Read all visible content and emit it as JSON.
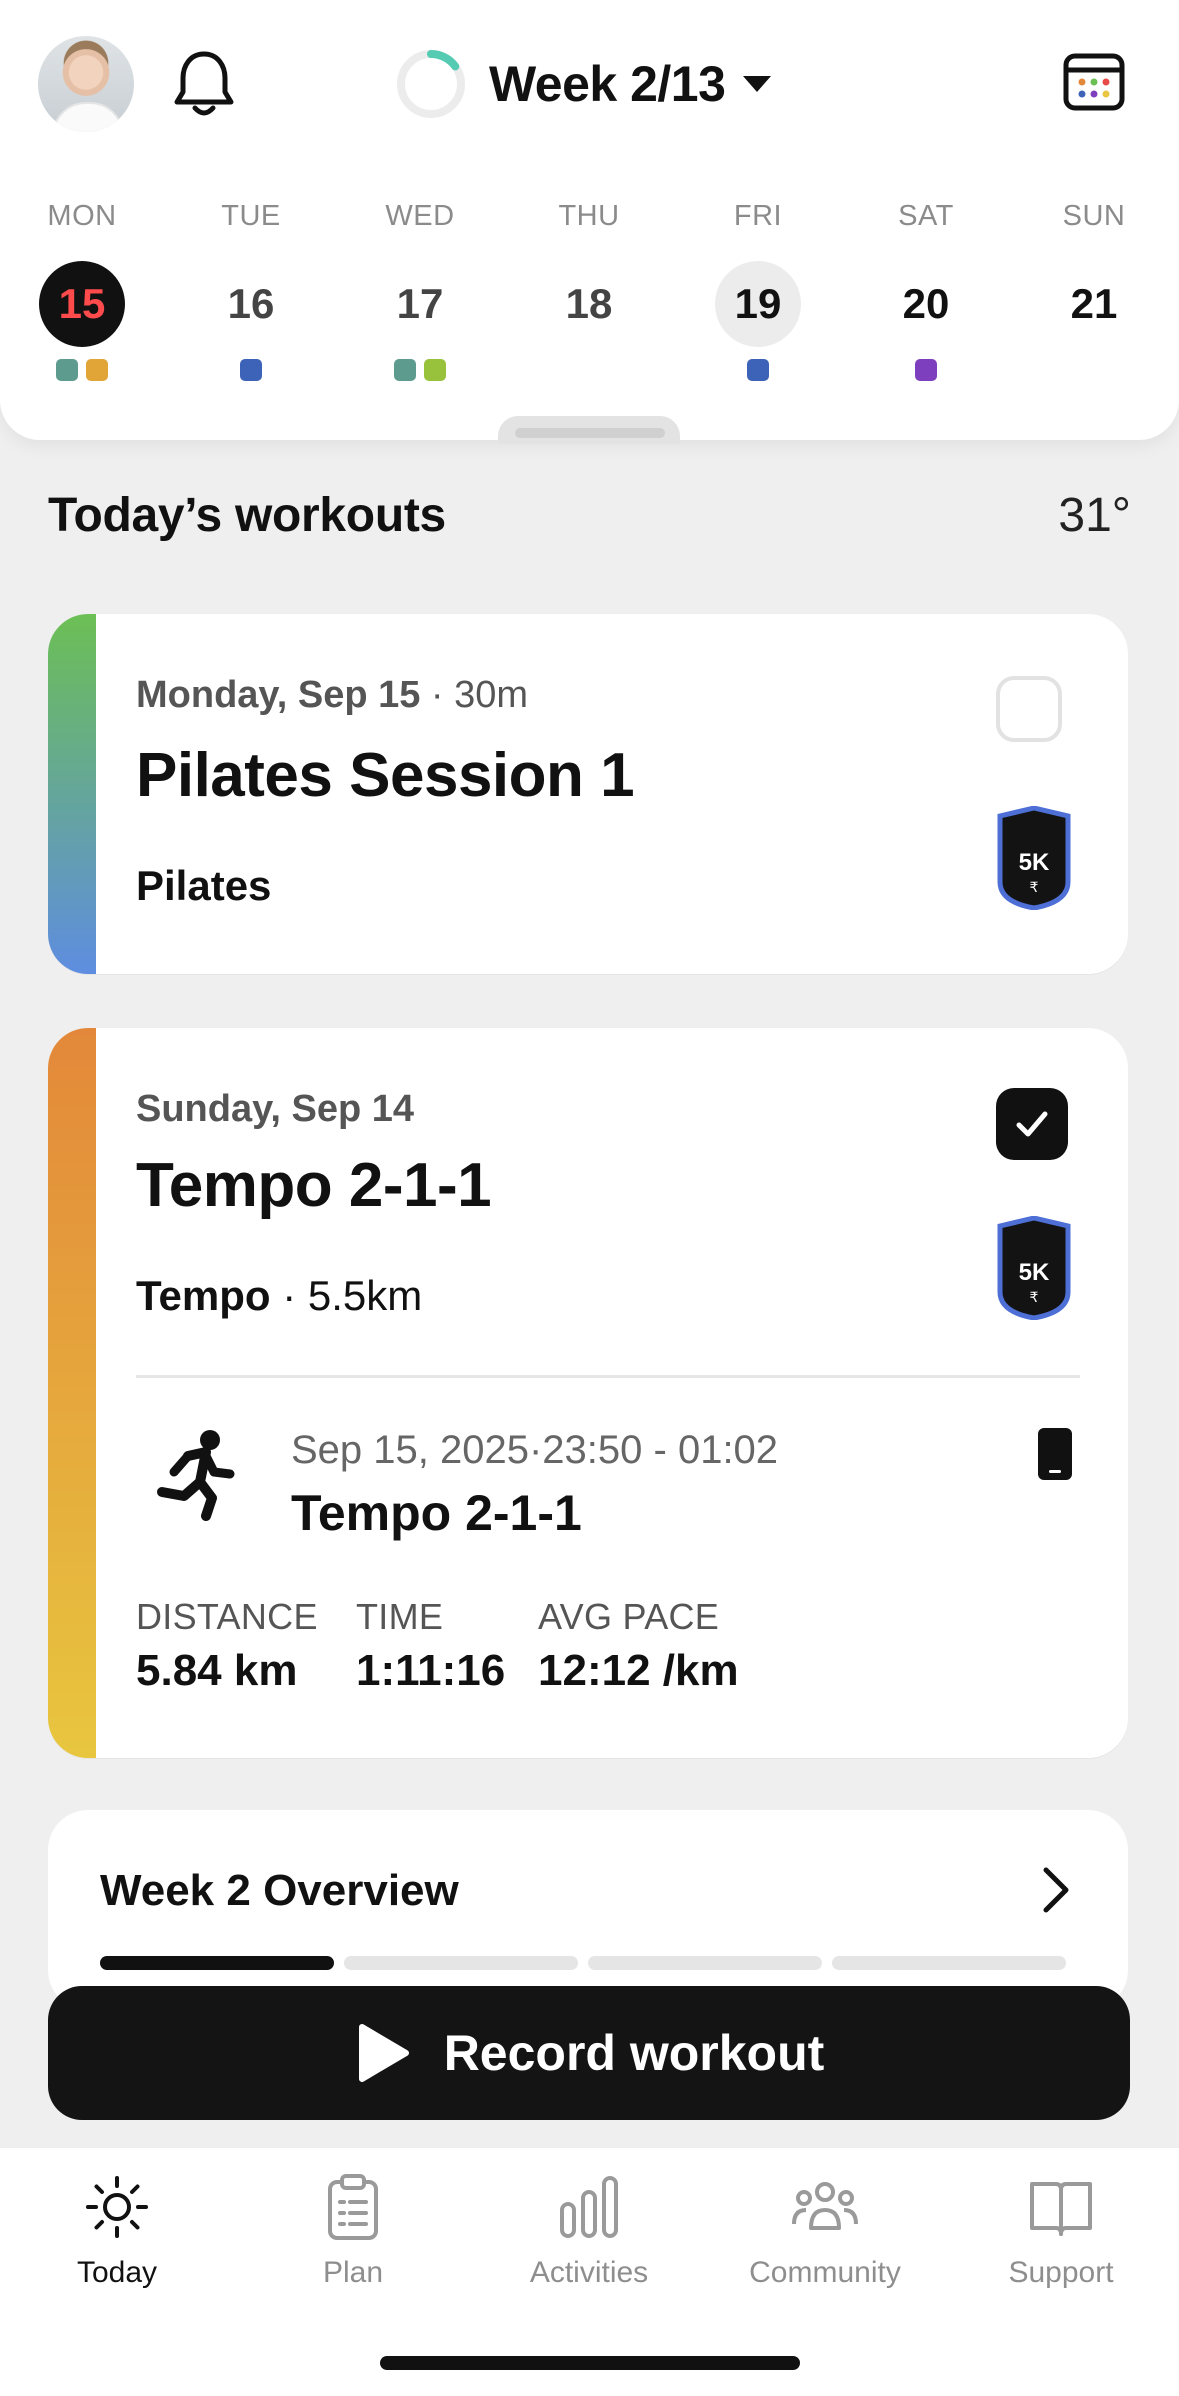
{
  "header": {
    "week_label": "Week 2/13",
    "week_progress": 0.15
  },
  "days": [
    {
      "name": "MON",
      "num": "15",
      "state": "today",
      "dots": [
        "#5d9b8e",
        "#e0a437"
      ]
    },
    {
      "name": "TUE",
      "num": "16",
      "state": "normal",
      "dots": [
        "#3d63b8"
      ]
    },
    {
      "name": "WED",
      "num": "17",
      "state": "normal",
      "dots": [
        "#5d9b8e",
        "#98c23b"
      ]
    },
    {
      "name": "THU",
      "num": "18",
      "state": "normal",
      "dots": []
    },
    {
      "name": "FRI",
      "num": "19",
      "state": "selected",
      "dots": [
        "#3d63b8"
      ]
    },
    {
      "name": "SAT",
      "num": "20",
      "state": "dark",
      "dots": [
        "#7e3fbf"
      ]
    },
    {
      "name": "SUN",
      "num": "21",
      "state": "dark",
      "dots": []
    }
  ],
  "section": {
    "title": "Today’s workouts",
    "temperature": "31°"
  },
  "workout1": {
    "date": "Monday, Sep 15",
    "separator": " · ",
    "duration": "30m",
    "title": "Pilates Session 1",
    "type": "Pilates",
    "badge": "5K",
    "badge_sub": "₹",
    "completed": false,
    "stripe_colors": [
      "#6cbf54",
      "#5e8de0"
    ]
  },
  "workout2": {
    "date": "Sunday, Sep 14",
    "title": "Tempo 2-1-1",
    "type": "Tempo",
    "separator": " · ",
    "distance": "5.5km",
    "badge": "5K",
    "badge_sub": "₹",
    "completed": true,
    "stripe_colors": [
      "#e3883a",
      "#e8c63f"
    ],
    "activity": {
      "datetime": "Sep 15, 2025·23:50 - 01:02",
      "name": "Tempo 2-1-1",
      "stats": [
        {
          "label": "DISTANCE",
          "value": "5.84 km"
        },
        {
          "label": "TIME",
          "value": "1:11:16"
        },
        {
          "label": "AVG PACE",
          "value": "12:12 /km"
        }
      ]
    }
  },
  "overview": {
    "title": "Week 2 Overview",
    "progress": [
      1,
      0,
      0,
      0
    ]
  },
  "record": {
    "label": "Record workout"
  },
  "nav": [
    {
      "label": "Today",
      "icon": "sun-icon",
      "active": true
    },
    {
      "label": "Plan",
      "icon": "clipboard-icon",
      "active": false
    },
    {
      "label": "Activities",
      "icon": "bar-chart-icon",
      "active": false
    },
    {
      "label": "Community",
      "icon": "people-icon",
      "active": false
    },
    {
      "label": "Support",
      "icon": "book-icon",
      "active": false
    }
  ],
  "colors": {
    "accent_today": "#ff4b4b",
    "badge_blue": "#4d6fd6"
  }
}
